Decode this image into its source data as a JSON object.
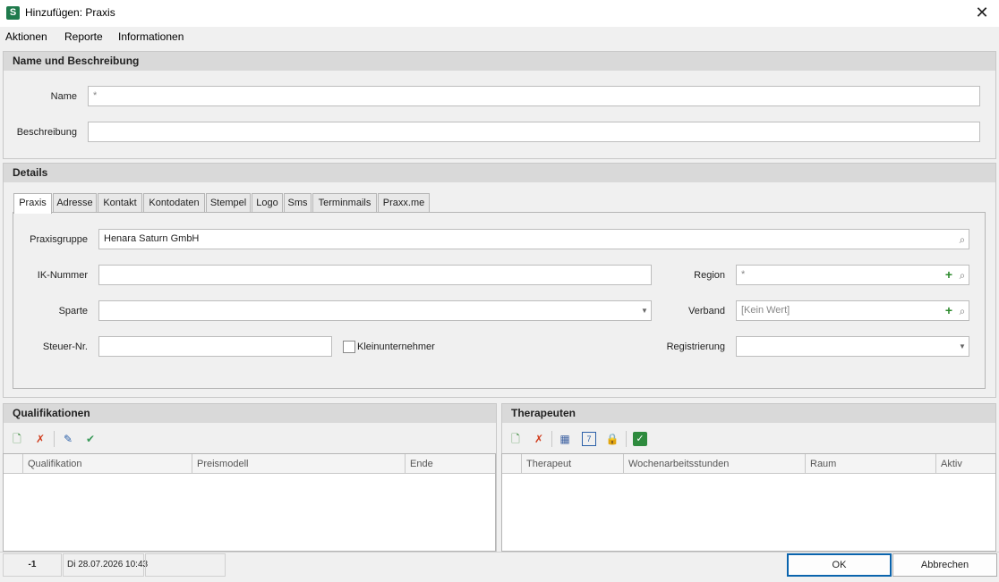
{
  "window": {
    "title": "Hinzufügen: Praxis",
    "app_icon_letter": "S",
    "close_glyph": "✕"
  },
  "menu": [
    "Aktionen",
    "Reporte",
    "Informationen"
  ],
  "name_group": {
    "title": "Name und Beschreibung",
    "name_label": "Name",
    "name_value": "*",
    "desc_label": "Beschreibung",
    "desc_value": ""
  },
  "details": {
    "title": "Details",
    "tabs": [
      "Praxis",
      "Adresse",
      "Kontakt",
      "Kontodaten",
      "Stempel",
      "Logo",
      "Sms",
      "Terminmails",
      "Praxx.me"
    ],
    "active_tab": "Praxis",
    "praxisgruppe_label": "Praxisgruppe",
    "praxisgruppe_value": "Henara Saturn GmbH",
    "ik_label": "IK-Nummer",
    "ik_value": "",
    "sparte_label": "Sparte",
    "sparte_value": "",
    "steuer_label": "Steuer-Nr.",
    "steuer_value": "",
    "klein_label": "Kleinunternehmer",
    "klein_checked": false,
    "region_label": "Region",
    "region_value": "*",
    "verband_label": "Verband",
    "verband_value": "[Kein Wert]",
    "reg_label": "Registrierung",
    "reg_value": ""
  },
  "qualifikationen": {
    "title": "Qualifikationen",
    "columns": [
      "Qualifikation",
      "Preismodell",
      "Ende"
    ],
    "toolbar_icons": [
      "add-icon",
      "delete-icon",
      "edit-icon",
      "check-icon"
    ]
  },
  "therapeuten": {
    "title": "Therapeuten",
    "columns": [
      "Therapeut",
      "Wochenarbeitsstunden",
      "Raum",
      "Aktiv"
    ],
    "toolbar_icons": [
      "add-icon",
      "delete-icon",
      "calendar-grid-icon",
      "calendar-day-icon",
      "lock-icon",
      "check-box-icon"
    ]
  },
  "status": {
    "id": "-1",
    "datetime": "Di 28.07.2026 10:43"
  },
  "buttons": {
    "ok": "OK",
    "cancel": "Abbrechen"
  },
  "colors": {
    "accent": "#0a64ad",
    "group_header": "#d9d9d9",
    "add_green": "#2d8a2d",
    "app_icon": "#1f7a4c"
  }
}
